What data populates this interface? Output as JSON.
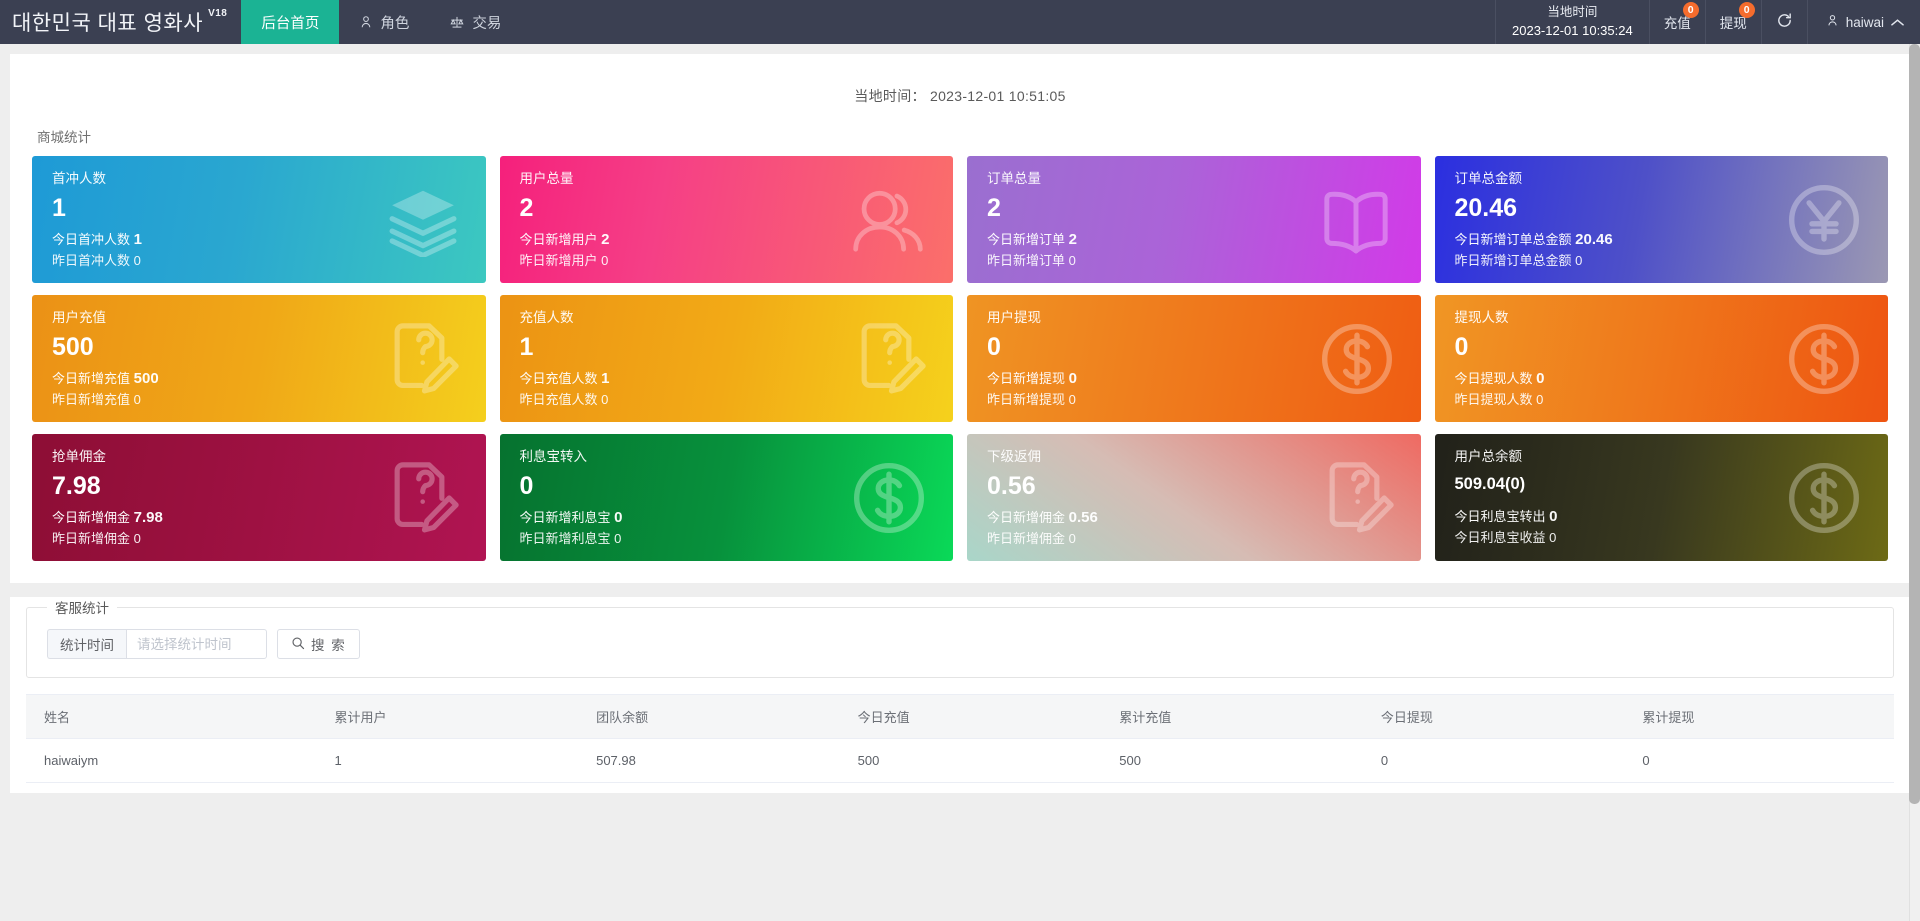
{
  "header": {
    "brand": "대한민국 대표 영화사",
    "brand_version": "V18",
    "nav": [
      {
        "label": "后台首页",
        "icon": "home-icon",
        "active": true
      },
      {
        "label": "角色",
        "icon": "person-icon",
        "active": false
      },
      {
        "label": "交易",
        "icon": "scales-icon",
        "active": false
      }
    ],
    "local_time_label": "当地时间",
    "local_time_value": "2023-12-01 10:35:24",
    "recharge_label": "充值",
    "recharge_badge": "0",
    "withdraw_label": "提现",
    "withdraw_badge": "0",
    "refresh_icon": "refresh-icon",
    "user_name": "haiwai",
    "user_icon": "person-icon",
    "caret_icon": "chevron-up-icon"
  },
  "main": {
    "local_time_line": "当地时间： 2023-12-01 10:51:05",
    "section_label": "商城统计",
    "cards": [
      {
        "title": "首冲人数",
        "value": "1",
        "today_label": "今日首冲人数",
        "today_value": "1",
        "yesterday_label": "昨日首冲人数",
        "yesterday_value": "0",
        "icon": "layers-icon",
        "gradient": "linear-gradient(100deg, #1e9ad6 0%, #2aa7d0 45%, #3cc8c0 100%)"
      },
      {
        "title": "用户总量",
        "value": "2",
        "today_label": "今日新增用户",
        "today_value": "2",
        "yesterday_label": "昨日新增用户",
        "yesterday_value": "0",
        "icon": "users-icon",
        "gradient": "linear-gradient(100deg, #f5207c 0%, #f53f86 35%, #fb6f6a 100%)"
      },
      {
        "title": "订单总量",
        "value": "2",
        "today_label": "今日新增订单",
        "today_value": "2",
        "yesterday_label": "昨日新增订单",
        "yesterday_value": "0",
        "icon": "book-icon",
        "gradient": "linear-gradient(100deg, #9a6fd0 0%, #ab63d8 45%, #d23ae8 100%)"
      },
      {
        "title": "订单总金额",
        "value": "20.46",
        "today_label": "今日新增订单总金额",
        "today_value": "20.46",
        "yesterday_label": "昨日新增订单总金额",
        "yesterday_value": "0",
        "icon": "yen-circle-icon",
        "gradient": "linear-gradient(100deg, #2b2fe0 0%, #4e50c8 45%, #9b98b3 100%)"
      },
      {
        "title": "用户充值",
        "value": "500",
        "today_label": "今日新增充值",
        "today_value": "500",
        "yesterday_label": "昨日新增充值",
        "yesterday_value": "0",
        "icon": "edit-doc-icon",
        "gradient": "linear-gradient(100deg, #eb9116 0%, #f0a817 50%, #f4cf1d 100%)"
      },
      {
        "title": "充值人数",
        "value": "1",
        "today_label": "今日充值人数",
        "today_value": "1",
        "yesterday_label": "昨日充值人数",
        "yesterday_value": "0",
        "icon": "edit-doc-icon",
        "gradient": "linear-gradient(100deg, #ec9314 0%, #f2aa16 50%, #f5d11c 100%)"
      },
      {
        "title": "用户提现",
        "value": "0",
        "today_label": "今日新增提现",
        "today_value": "0",
        "yesterday_label": "昨日新增提现",
        "yesterday_value": "0",
        "icon": "dollar-circle-icon",
        "gradient": "linear-gradient(100deg, #ef9423 0%, #ef7b1d 45%, #ef5d13 100%)"
      },
      {
        "title": "提现人数",
        "value": "0",
        "today_label": "今日提现人数",
        "today_value": "0",
        "yesterday_label": "昨日提现人数",
        "yesterday_value": "0",
        "icon": "dollar-circle-icon",
        "gradient": "linear-gradient(100deg, #f09624 0%, #ef7a1c 45%, #ee5411 100%)"
      },
      {
        "title": "抢单佣金",
        "value": "7.98",
        "today_label": "今日新增佣金",
        "today_value": "7.98",
        "yesterday_label": "昨日新增佣金",
        "yesterday_value": "0",
        "icon": "edit-doc-icon",
        "gradient": "linear-gradient(100deg, #8d0e35 0%, #9e1142 50%, #b01452 100%)"
      },
      {
        "title": "利息宝转入",
        "value": "0",
        "today_label": "今日新增利息宝",
        "today_value": "0",
        "yesterday_label": "昨日新增利息宝",
        "yesterday_value": "0",
        "icon": "dollar-circle-icon",
        "gradient": "linear-gradient(100deg, #06722f 0%, #07913c 50%, #0ad958 100%)"
      },
      {
        "title": "下级返佣",
        "value": "0.56",
        "today_label": "今日新增佣金",
        "today_value": "0.56",
        "yesterday_label": "昨日新增佣金",
        "yesterday_value": "0",
        "icon": "edit-doc-icon",
        "gradient": "linear-gradient(35deg, #a9d6c9 0%, #d6bcb4 45%, #ef6a62 100%)"
      },
      {
        "title": "用户总余额",
        "value": "509.04(0)",
        "today_label": "今日利息宝转出",
        "today_value": "0",
        "yesterday_label": "今日利息宝收益",
        "yesterday_value": "0",
        "icon": "dollar-circle-icon",
        "gradient": "linear-gradient(100deg, #21211a 0%, #38381f 50%, #6d6a15 100%)",
        "small_value": true
      }
    ]
  },
  "customer_service": {
    "legend": "客服统计",
    "filter_label": "统计时间",
    "filter_placeholder": "请选择统计时间",
    "filter_value": "",
    "search_button": "搜 索",
    "search_icon": "search-icon",
    "table": {
      "columns": [
        "姓名",
        "累计用户",
        "团队余额",
        "今日充值",
        "累计充值",
        "今日提现",
        "累计提现"
      ],
      "rows": [
        [
          "haiwaiym",
          "1",
          "507.98",
          "500",
          "500",
          "0",
          "0"
        ]
      ]
    }
  }
}
